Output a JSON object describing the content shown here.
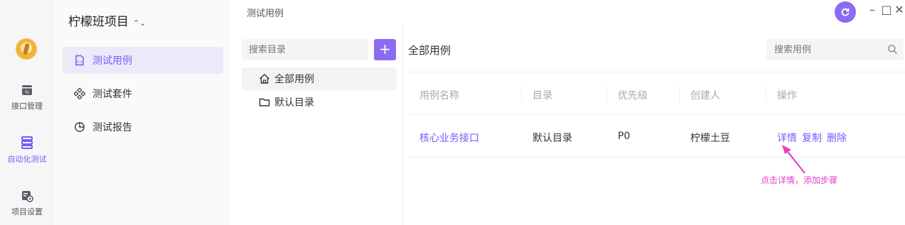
{
  "rail": {
    "items": [
      {
        "label": "接口管理",
        "icon": "api-management-icon"
      },
      {
        "label": "自动化测试",
        "icon": "automation-test-icon"
      },
      {
        "label": "项目设置",
        "icon": "project-settings-icon"
      }
    ]
  },
  "project": {
    "name": "柠檬班项目"
  },
  "nav": {
    "items": [
      {
        "label": "测试用例",
        "icon": "test-case-icon"
      },
      {
        "label": "测试套件",
        "icon": "test-suite-icon"
      },
      {
        "label": "测试报告",
        "icon": "test-report-icon"
      }
    ]
  },
  "header": {
    "breadcrumb": "测试用例",
    "accent": "#8b6cf0"
  },
  "folders": {
    "search_placeholder": "搜索目录",
    "add_label": "+",
    "items": [
      {
        "label": "全部用例",
        "icon": "home-icon"
      },
      {
        "label": "默认目录",
        "icon": "folder-icon"
      }
    ]
  },
  "main": {
    "title": "全部用例",
    "search_placeholder": "搜索用例",
    "columns": [
      "用例名称",
      "目录",
      "优先级",
      "创建人",
      "操作"
    ],
    "rows": [
      {
        "name": "核心业务接口",
        "dir": "默认目录",
        "priority": "P0",
        "creator": "柠檬土豆",
        "actions": [
          "详情",
          "复制",
          "删除"
        ]
      }
    ]
  },
  "annotation": {
    "text": "点击详情，添加步骤",
    "color": "#e040c8"
  }
}
